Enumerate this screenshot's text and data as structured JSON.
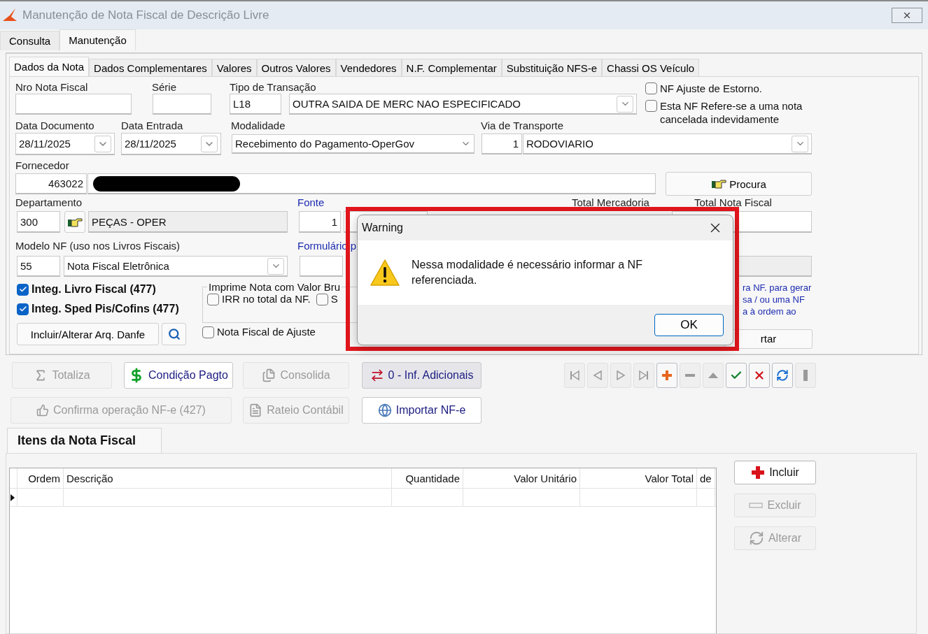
{
  "window": {
    "title": "Manutenção de Nota Fiscal de Descrição Livre"
  },
  "main_tabs": [
    {
      "label": "Consulta",
      "selected": false
    },
    {
      "label": "Manutenção",
      "selected": true
    }
  ],
  "form_tabs": [
    {
      "label": "Dados da Nota",
      "selected": true
    },
    {
      "label": "Dados Complementares",
      "selected": false
    },
    {
      "label": "Valores",
      "selected": false
    },
    {
      "label": "Outros Valores",
      "selected": false
    },
    {
      "label": "Vendedores",
      "selected": false
    },
    {
      "label": "N.F. Complementar",
      "selected": false
    },
    {
      "label": "Substituição NFS-e",
      "selected": false
    },
    {
      "label": "Chassi OS Veículo",
      "selected": false
    }
  ],
  "form": {
    "nro_nota_fiscal": {
      "label": "Nro Nota Fiscal"
    },
    "serie": {
      "label": "Série"
    },
    "tipo_transacao": {
      "label": "Tipo de Transação",
      "code": "L18",
      "value": "OUTRA SAIDA DE MERC NAO ESPECIFICADO"
    },
    "flags": [
      {
        "label": "NF Ajuste de Estorno.",
        "checked": false
      },
      {
        "label": "Esta NF Refere-se a uma nota cancelada indevidamente",
        "checked": false
      }
    ],
    "data_documento": {
      "label": "Data Documento",
      "value": "28/11/2025"
    },
    "data_entrada": {
      "label": "Data Entrada",
      "value": "28/11/2025"
    },
    "modalidade": {
      "label": "Modalidade",
      "value": "Recebimento do Pagamento-OperGov"
    },
    "via_transporte": {
      "label": "Via de Transporte",
      "code": "1",
      "value": "RODOVIARIO"
    },
    "fornecedor": {
      "label": "Fornecedor",
      "code": "463022"
    },
    "procura_button": "Procura",
    "departamento": {
      "label": "Departamento",
      "code": "300",
      "value": "PEÇAS - OPER"
    },
    "fonte": {
      "label": "Fonte",
      "code": "1"
    },
    "total_mercadoria": {
      "label": "Total Mercadoria"
    },
    "total_nota_fiscal": {
      "label": "Total Nota Fiscal"
    },
    "modelo_nf": {
      "label": "Modelo NF (uso nos Livros Fiscais)",
      "code": "55",
      "value": "Nota Fiscal Eletrônica"
    },
    "formulario": {
      "label": "Formulário p"
    },
    "integ_checks": [
      {
        "label": "Integ. Livro Fiscal (477)",
        "checked": true
      },
      {
        "label": "Integ. Sped Pis/Cofins (477)",
        "checked": true
      }
    ],
    "danfe_button": "Incluir/Alterar Arq. Danfe",
    "imprime_group": {
      "legend": "Imprime Nota com Valor Bru",
      "options": [
        {
          "label": "IRR no total da NF.",
          "checked": false
        },
        {
          "label": "S",
          "checked": false
        }
      ]
    },
    "nota_ajuste": {
      "label": "Nota Fiscal de Ajuste",
      "checked": false
    },
    "hint_lines": [
      "ra NF. para gerar",
      "sa / ou uma NF",
      "a à ordem ao"
    ],
    "cut_button": "rtar"
  },
  "actions": [
    [
      {
        "label": "Totaliza",
        "kind": "sigma",
        "disabled": true,
        "focused": false
      },
      {
        "label": "Condição Pagto",
        "kind": "dollar",
        "disabled": false,
        "focused": false
      },
      {
        "label": "Consolida",
        "kind": "docs",
        "disabled": true,
        "focused": false
      },
      {
        "label": "0 - Inf. Adicionais",
        "kind": "arrows",
        "disabled": false,
        "focused": true
      }
    ],
    [
      {
        "label": "Confirma operação NF-e (427)",
        "kind": "thumb",
        "disabled": true,
        "focused": false
      },
      {
        "label": "Rateio Contábil",
        "kind": "sheet",
        "disabled": true,
        "focused": false
      },
      {
        "label": "Importar NF-e",
        "kind": "globe",
        "disabled": false,
        "focused": false
      }
    ]
  ],
  "nav_buttons": [
    {
      "kind": "first",
      "disabled": true
    },
    {
      "kind": "prev",
      "disabled": true
    },
    {
      "kind": "next",
      "disabled": true
    },
    {
      "kind": "last",
      "disabled": true
    },
    {
      "kind": "insert",
      "disabled": false
    },
    {
      "kind": "delete",
      "disabled": true
    },
    {
      "kind": "edit",
      "disabled": true
    },
    {
      "kind": "post",
      "disabled": false
    },
    {
      "kind": "cancel",
      "disabled": false
    },
    {
      "kind": "refresh",
      "disabled": false
    },
    {
      "kind": "bar",
      "disabled": true
    }
  ],
  "items": {
    "title": "Itens da Nota Fiscal",
    "columns": [
      "Ordem",
      "Descrição",
      "Quantidade",
      "Valor Unitário",
      "Valor Total",
      "de"
    ],
    "rows": [
      {
        "current": true
      }
    ],
    "buttons": [
      {
        "label": "Incluir",
        "kind": "add",
        "disabled": false
      },
      {
        "label": "Excluir",
        "kind": "remove",
        "disabled": true
      },
      {
        "label": "Alterar",
        "kind": "change",
        "disabled": true
      }
    ]
  },
  "dialog": {
    "title": "Warning",
    "message": "Nessa modalidade é necessário informar a NF referenciada.",
    "button": "OK"
  }
}
